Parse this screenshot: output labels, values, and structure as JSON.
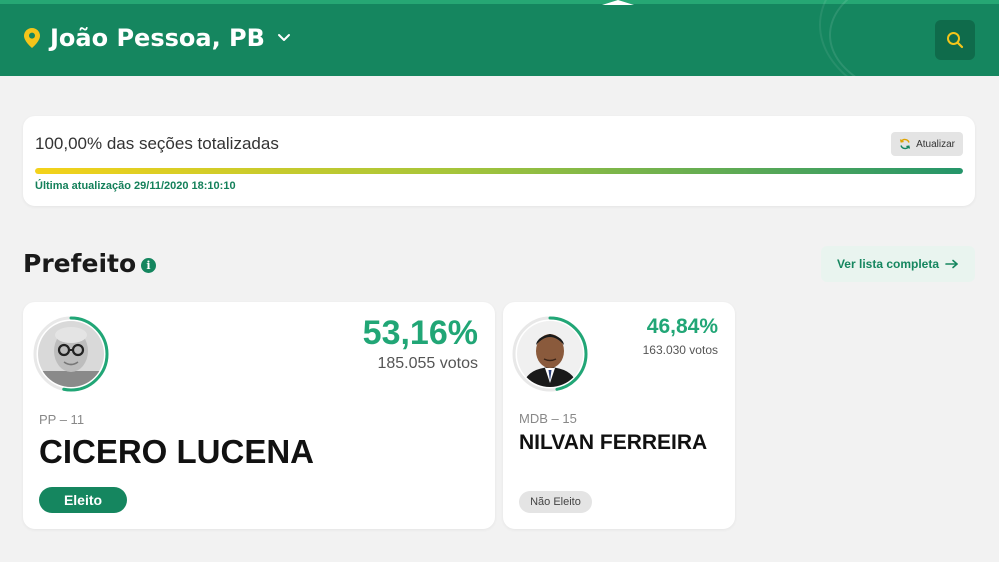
{
  "header": {
    "location": "João Pessoa, PB",
    "accent_color": "#15865f",
    "pin_color": "#f4c51a"
  },
  "status": {
    "sections_text": "100,00% das seções totalizadas",
    "progress_fraction": 1.0,
    "update_button_label": "Atualizar",
    "last_update": "Última atualização 29/11/2020 18:10:10"
  },
  "section": {
    "title": "Prefeito",
    "info_icon": "info-icon",
    "full_list_label": "Ver lista completa"
  },
  "candidates": [
    {
      "percent": "53,16%",
      "percent_fraction": 0.5316,
      "votes": "185.055 votos",
      "party": "PP – 11",
      "name": "CICERO LUCENA",
      "status": "Eleito"
    },
    {
      "percent": "46,84%",
      "percent_fraction": 0.4684,
      "votes": "163.030 votos",
      "party": "MDB – 15",
      "name": "NILVAN FERREIRA",
      "status": "Não Eleito"
    }
  ]
}
